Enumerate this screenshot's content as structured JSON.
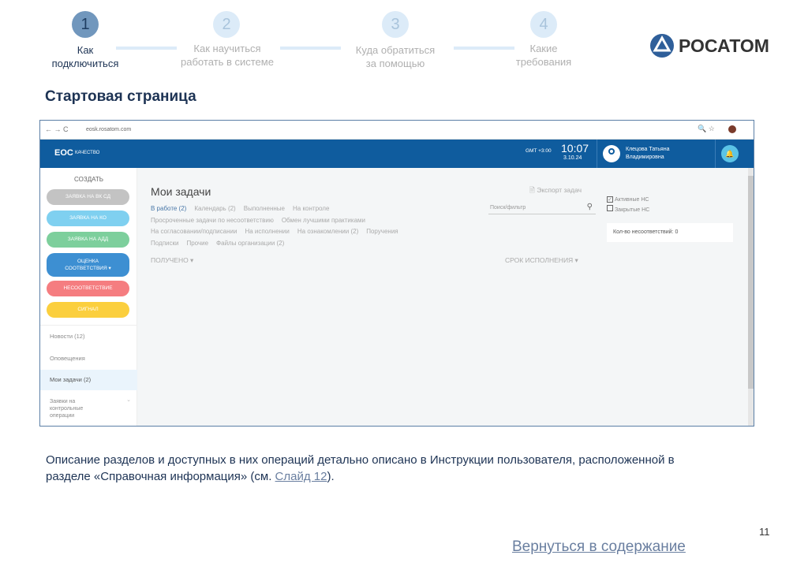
{
  "steps": [
    {
      "num": "1",
      "line1": "Как",
      "line2": "подключиться",
      "active": true
    },
    {
      "num": "2",
      "line1": "Как научиться",
      "line2": "работать в системе"
    },
    {
      "num": "3",
      "line1": "Куда обратиться",
      "line2": "за помощью"
    },
    {
      "num": "4",
      "line1": "Какие",
      "line2": "требования"
    }
  ],
  "logo": {
    "text": "РОСАТОМ"
  },
  "page_title": "Стартовая страница",
  "screenshot": {
    "url": "eosk.rosatom.com",
    "app_logo": "ЕОС",
    "app_sub": "КАЧЕСТВО",
    "timezone": "GMT +3:00",
    "time": "10:07",
    "date": "3.10.24",
    "user_line1": "Клецова Татьяна",
    "user_line2": "Владимировна",
    "sidebar": {
      "create": "СОЗДАТЬ",
      "buttons": [
        "ЗАЯВКА НА ВК СД",
        "ЗАЯВКА НА КО",
        "ЗАЯВКА НА АДД",
        "ОЦЕНКА",
        "СООТВЕТСТВИЯ ▾",
        "НЕСООТВЕТСТВИЕ",
        "СИГНАЛ"
      ],
      "nav": [
        "Новости (12)",
        "Оповещения",
        "Мои задачи (2)",
        "Заявки на",
        "контрольные",
        "операции"
      ]
    },
    "main": {
      "title": "Мои задачи",
      "export": "Экспорт задач",
      "tabs_row1": [
        "В работе (2)",
        "Календарь (2)",
        "Выполненные",
        "На контроле"
      ],
      "tabs_row2": [
        "Просроченные задачи по несоответствию",
        "Обмен лучшими практиками"
      ],
      "tabs_row3": [
        "На согласовании/подписании",
        "На исполнении",
        "На ознакомлении (2)",
        "Поручения"
      ],
      "tabs_row4": [
        "Подписки",
        "Прочие",
        "Файлы организации (2)"
      ],
      "search_placeholder": "Поиск/фильтр",
      "col_received": "ПОЛУЧЕНО ▾",
      "col_deadline": "СРОК ИСПОЛНЕНИЯ ▾",
      "check_active": "Активные НС",
      "check_closed": "Закрытые НС",
      "count": "Кол-во несоответствий: 0"
    }
  },
  "description": "Описание разделов и доступных в них операций детально описано в Инструкции пользователя, расположенной в разделе «Справочная информация» (см. ",
  "slide_link": "Слайд 12",
  "description_end": ").",
  "page_number": "11",
  "back_link": "Вернуться в содержание"
}
